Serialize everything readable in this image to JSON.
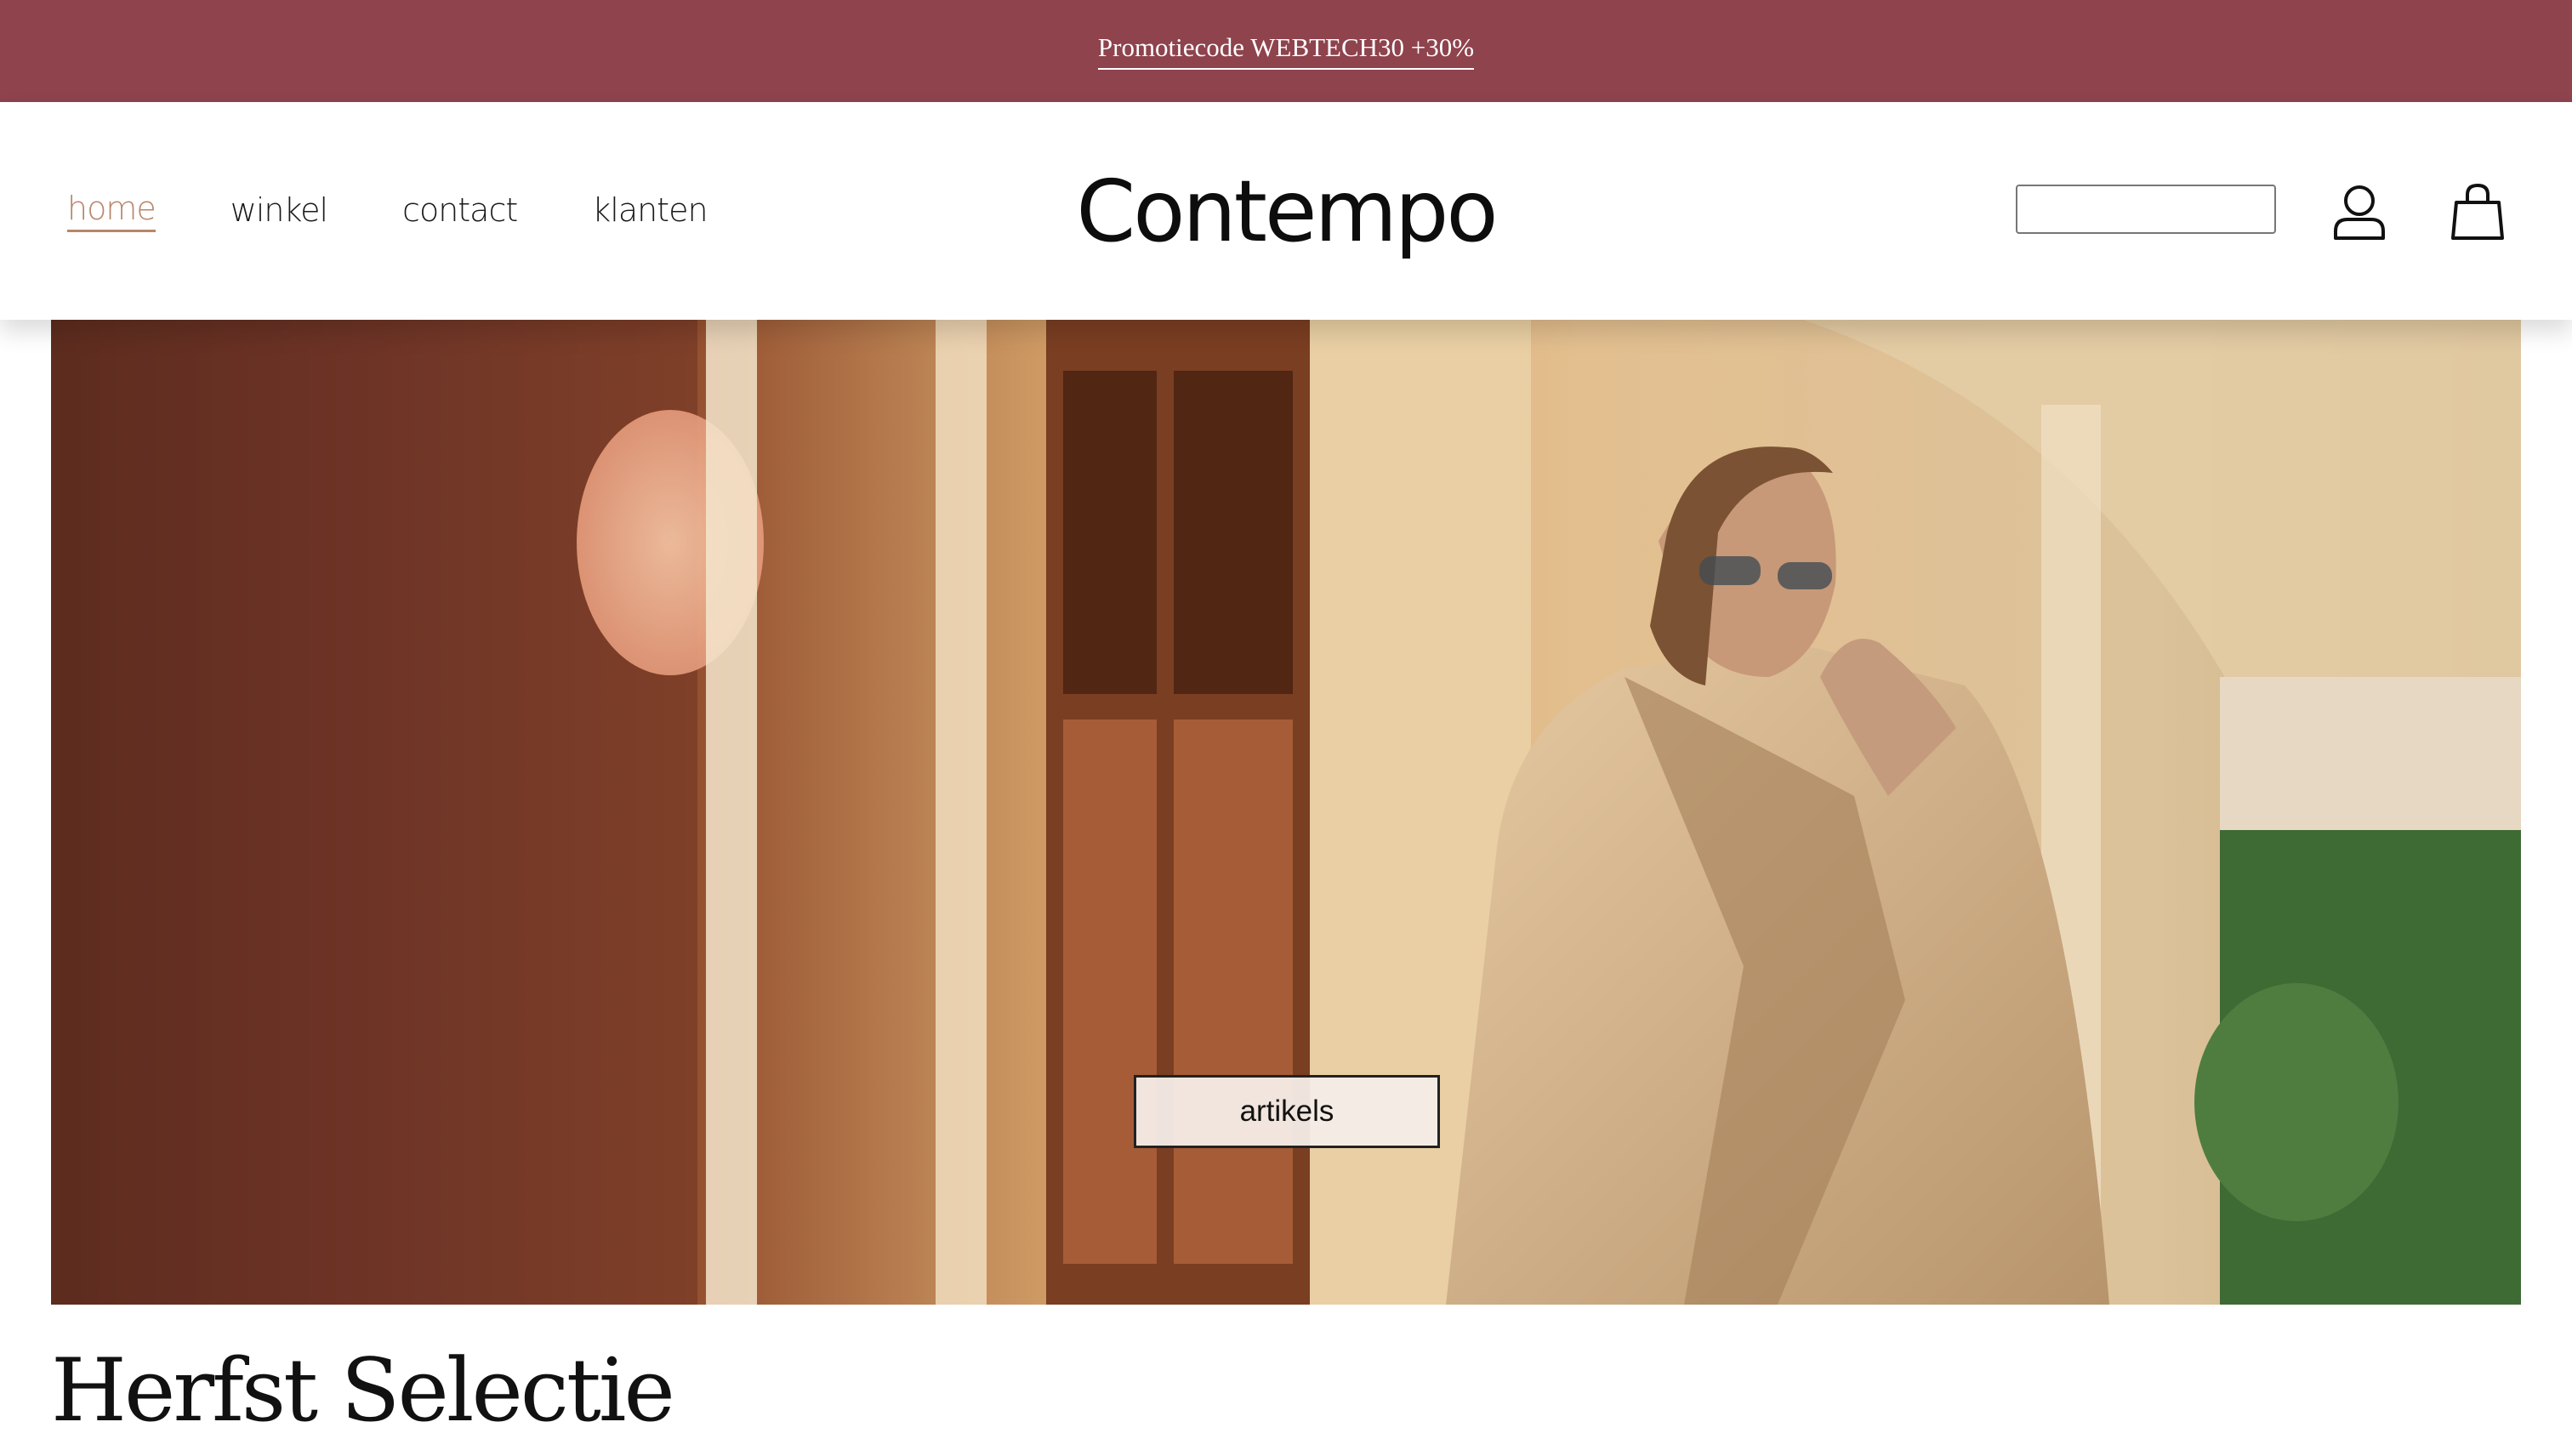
{
  "promo": {
    "text": "Promotiecode WEBTECH30 +30%"
  },
  "nav": {
    "items": [
      {
        "label": "home",
        "active": true
      },
      {
        "label": "winkel"
      },
      {
        "label": "contact"
      },
      {
        "label": "klanten"
      }
    ]
  },
  "brand": {
    "logo_text": "Contempo"
  },
  "search": {
    "value": "",
    "placeholder": ""
  },
  "header_icons": {
    "account": "user-icon",
    "cart": "shopping-bag-icon"
  },
  "hero": {
    "button_label": "artikels"
  },
  "section": {
    "title": "Herfst Selectie"
  },
  "colors": {
    "promo_background": "#8e434d",
    "active_nav": "#b9856b",
    "text": "#111111",
    "hero_button_background": "#f4ece8"
  }
}
